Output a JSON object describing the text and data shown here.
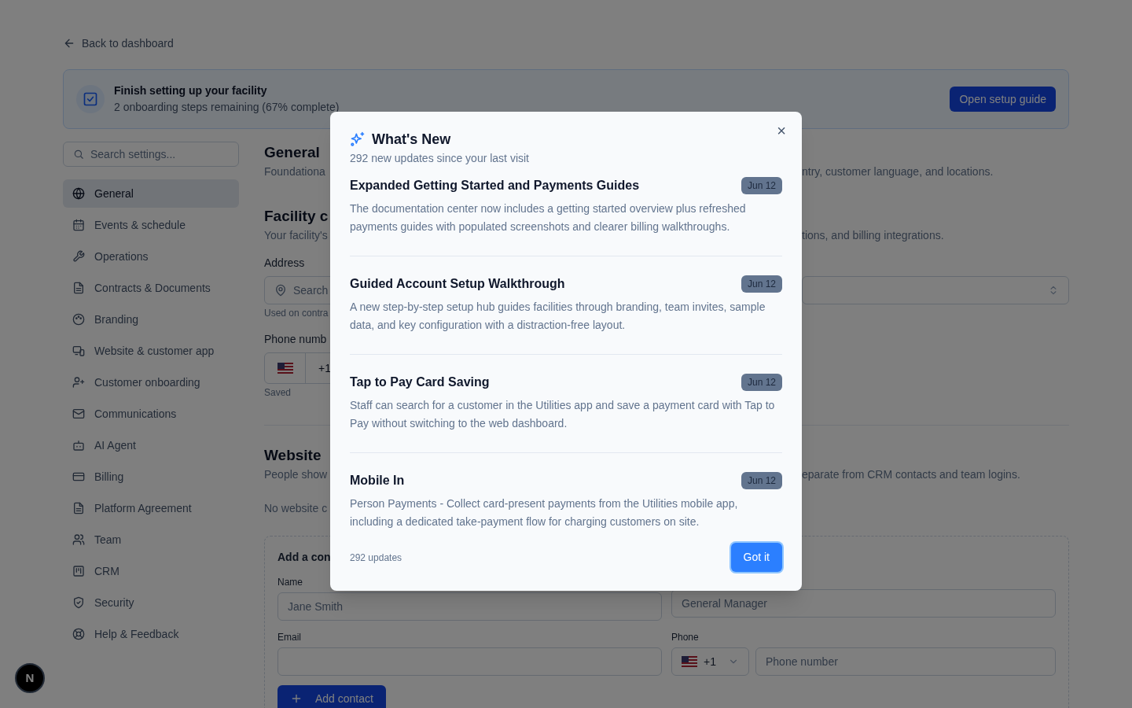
{
  "back_link": "Back to dashboard",
  "setup_banner": {
    "title": "Finish setting up your facility",
    "subtitle": "2 onboarding steps remaining (67% complete)",
    "button": "Open setup guide"
  },
  "sidebar": {
    "search_placeholder": "Search settings...",
    "items": [
      {
        "label": "General",
        "selected": true
      },
      {
        "label": "Events & schedule",
        "selected": false
      },
      {
        "label": "Operations",
        "selected": false
      },
      {
        "label": "Contracts & Documents",
        "selected": false
      },
      {
        "label": "Branding",
        "selected": false
      },
      {
        "label": "Website & customer app",
        "selected": false
      },
      {
        "label": "Customer onboarding",
        "selected": false
      },
      {
        "label": "Communications",
        "selected": false
      },
      {
        "label": "AI Agent",
        "selected": false
      },
      {
        "label": "Billing",
        "selected": false
      },
      {
        "label": "Platform Agreement",
        "selected": false
      },
      {
        "label": "Team",
        "selected": false
      },
      {
        "label": "CRM",
        "selected": false
      },
      {
        "label": "Security",
        "selected": false
      },
      {
        "label": "Help & Feedback",
        "selected": false
      }
    ]
  },
  "general": {
    "heading": "General",
    "desc_left": "Foundationa",
    "desc_right": "ntry, customer language, and locations."
  },
  "facility": {
    "heading": "Facility c",
    "desc_left": "Your facility's",
    "desc_right": "tions, and billing integrations.",
    "address_label": "Address",
    "address_placeholder": "Search",
    "address_hint": "Used on contra",
    "phone_label": "Phone numb",
    "phone_code": "+1",
    "phone_status": "Saved"
  },
  "website": {
    "heading": "Website",
    "desc_left": "People show",
    "desc_right": "eparate from CRM contacts and team logins.",
    "empty": "No website c",
    "form": {
      "title": "Add a con",
      "name_label": "Name",
      "name_placeholder": "Jane Smith",
      "role_placeholder": "General Manager",
      "email_label": "Email",
      "phone_label": "Phone",
      "phone_code": "+1",
      "phone_placeholder": "Phone number",
      "button": "Add contact"
    }
  },
  "launcher": "N",
  "modal": {
    "title": "What's New",
    "subtitle": "292 new updates since your last visit",
    "close": "×",
    "items": [
      {
        "title": "Expanded Getting Started and Payments Guides",
        "date": "Jun 12",
        "text": "The documentation center now includes a getting started overview plus refreshed payments guides with populated screenshots and clearer billing walkthroughs."
      },
      {
        "title": "Guided Account Setup Walkthrough",
        "date": "Jun 12",
        "text": "A new step-by-step setup hub guides facilities through branding, team invites, sample data, and key configuration with a distraction-free layout."
      },
      {
        "title": "Tap to Pay Card Saving",
        "date": "Jun 12",
        "text": "Staff can search for a customer in the Utilities app and save a payment card with Tap to Pay without switching to the web dashboard."
      },
      {
        "title": "Mobile In",
        "date": "Jun 12",
        "text": "Person Payments - Collect card-present payments from the Utilities mobile app, including a dedicated take-payment flow for charging customers on site."
      }
    ],
    "footer_count": "292 updates",
    "button": "Got it"
  }
}
